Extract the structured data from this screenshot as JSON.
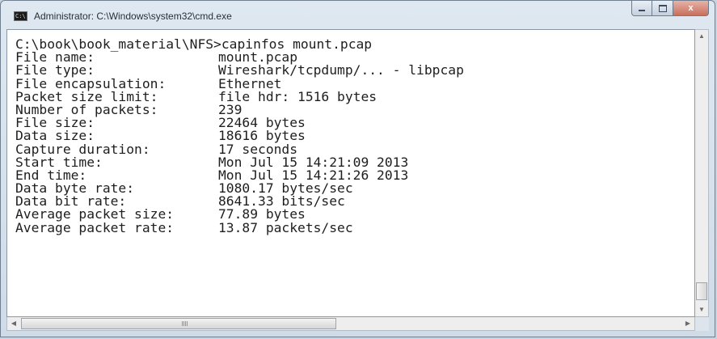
{
  "window": {
    "title": "Administrator: C:\\Windows\\system32\\cmd.exe",
    "icon_text": "C:\\",
    "controls": {
      "minimize": "minimize",
      "maximize": "maximize",
      "close": "x"
    }
  },
  "console": {
    "command": "C:\\book\\book_material\\NFS>capinfos mount.pcap",
    "rows": [
      {
        "label": "File name:",
        "value": "mount.pcap"
      },
      {
        "label": "File type:",
        "value": "Wireshark/tcpdump/... - libpcap"
      },
      {
        "label": "File encapsulation:",
        "value": "Ethernet"
      },
      {
        "label": "Packet size limit:",
        "value": "file hdr: 1516 bytes"
      },
      {
        "label": "Number of packets:",
        "value": "239"
      },
      {
        "label": "File size:",
        "value": "22464 bytes"
      },
      {
        "label": "Data size:",
        "value": "18616 bytes"
      },
      {
        "label": "Capture duration:",
        "value": "17 seconds"
      },
      {
        "label": "Start time:",
        "value": "Mon Jul 15 14:21:09 2013"
      },
      {
        "label": "End time:",
        "value": "Mon Jul 15 14:21:26 2013"
      },
      {
        "label": "Data byte rate:",
        "value": "1080.17 bytes/sec"
      },
      {
        "label": "Data bit rate:",
        "value": "8641.33 bits/sec"
      },
      {
        "label": "Average packet size:",
        "value": "77.89 bytes"
      },
      {
        "label": "Average packet rate:",
        "value": "13.87 packets/sec"
      }
    ]
  },
  "scrollbars": {
    "vertical_position": 0.95,
    "horizontal_position": 0.0
  },
  "colors": {
    "console_background": "#ffffff",
    "console_text": "#1e1e1e",
    "close_button": "#c86f5c"
  }
}
